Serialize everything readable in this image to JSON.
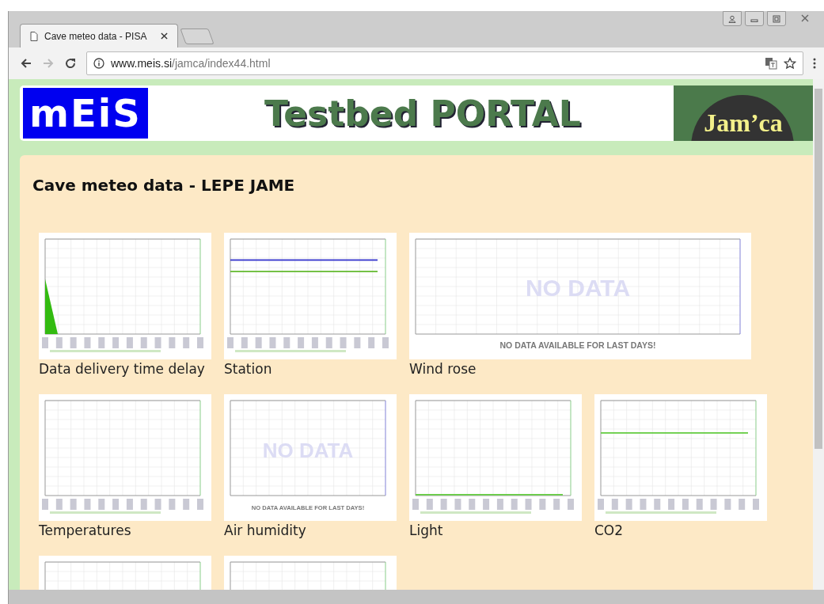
{
  "browser": {
    "tabs": [
      {
        "title": "Cave meteo data - PISA",
        "selected": true
      }
    ],
    "url": {
      "host": "www.meis.si",
      "path": "/jamca/index44.html"
    }
  },
  "header": {
    "logo": "mEiS",
    "title": "Testbed PORTAL",
    "badge": "Jam’ca"
  },
  "page": {
    "title": "Cave meteo data - LEPE JAME",
    "graphs": [
      {
        "caption": "Data delivery time delay",
        "kind": "picture",
        "wide": false
      },
      {
        "caption": "Station",
        "kind": "picture",
        "wide": false
      },
      {
        "caption": "Wind rose",
        "kind": "nodata",
        "wide": true,
        "watermark": "NO DATA",
        "message": "NO DATA AVAILABLE FOR LAST DAYS!"
      },
      {
        "caption": "Temperatures",
        "kind": "picture",
        "wide": false
      },
      {
        "caption": "Air humidity",
        "kind": "nodata",
        "wide": false,
        "watermark": "NO DATA",
        "message": "NO DATA AVAILABLE FOR LAST DAYS!"
      },
      {
        "caption": "Light",
        "kind": "picture",
        "wide": false
      },
      {
        "caption": "CO2",
        "kind": "picture",
        "wide": false
      },
      {
        "kind": "picture",
        "wide": false
      },
      {
        "kind": "picture",
        "wide": false
      }
    ]
  }
}
